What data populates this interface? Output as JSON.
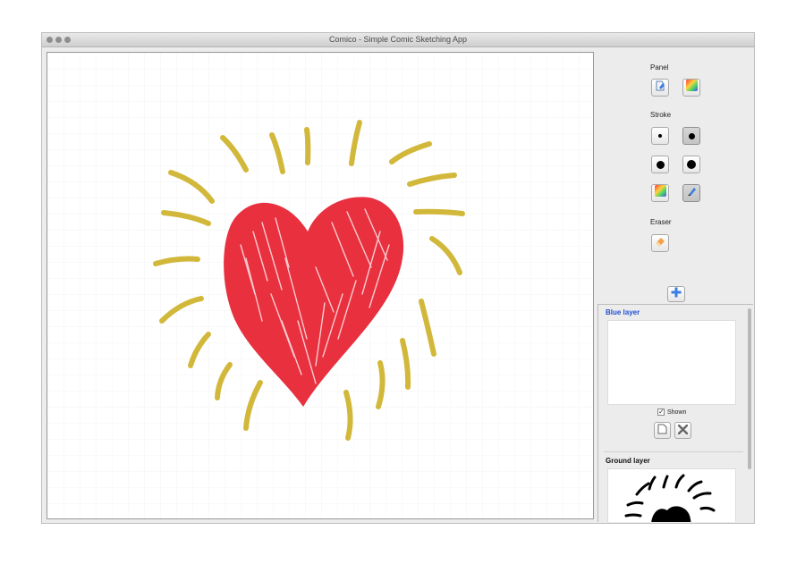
{
  "window": {
    "title": "Comico - Simple Comic Sketching App"
  },
  "toolbar": {
    "panel_label": "Panel",
    "panel_tools": [
      {
        "name": "panel-pen-icon"
      },
      {
        "name": "panel-color-icon"
      }
    ],
    "stroke_label": "Stroke",
    "stroke_sizes": [
      "small",
      "medium",
      "large",
      "x-large"
    ],
    "stroke_selected": "medium",
    "stroke_extras": [
      {
        "name": "stroke-color-icon"
      },
      {
        "name": "brush-icon",
        "selected": true
      }
    ],
    "eraser_label": "Eraser"
  },
  "layers": [
    {
      "name": "Blue layer",
      "shown_label": "Shown",
      "shown": true,
      "title_color": "#1f4fd6"
    },
    {
      "name": "Ground layer",
      "title_color": "#111111"
    }
  ],
  "colors": {
    "heart": "#e8303f",
    "rays": "#d2b83a",
    "accent": "#3b7de0"
  }
}
